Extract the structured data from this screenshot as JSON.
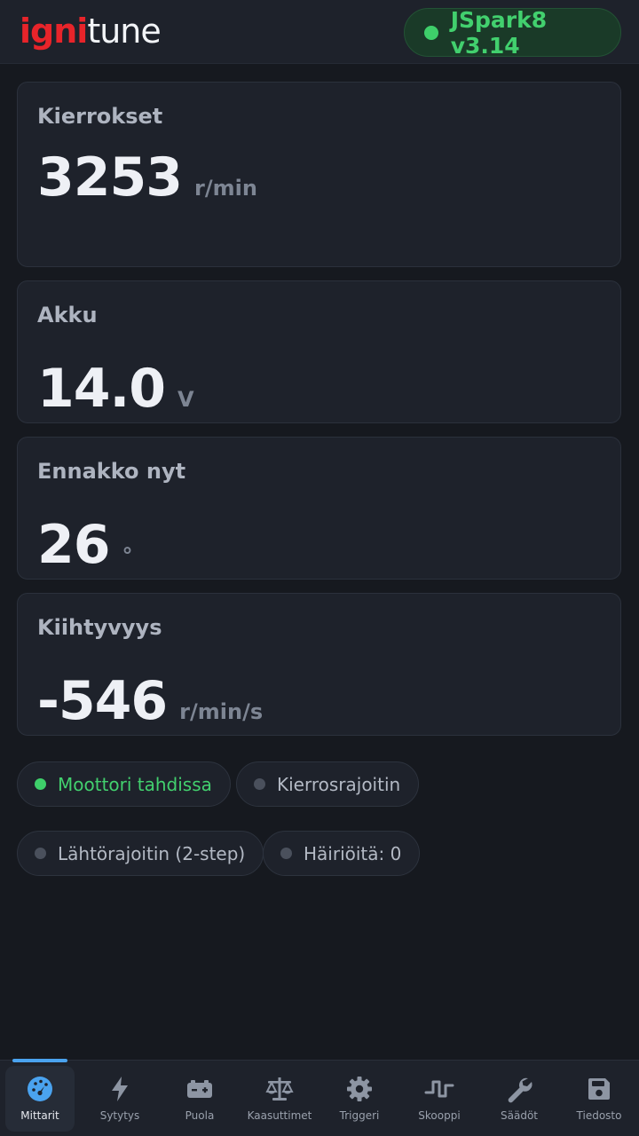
{
  "header": {
    "logo_part1": "igni",
    "logo_part2": "tune",
    "device_label": "JSpark8 v3.14",
    "device_status_color": "#3ecf6a"
  },
  "cards": [
    {
      "title": "Kierrokset",
      "value": "3253",
      "unit": "r/min"
    },
    {
      "title": "Akku",
      "value": "14.0",
      "unit": "V"
    },
    {
      "title": "Ennakko nyt",
      "value": "26",
      "unit": "°"
    },
    {
      "title": "Kiihtyvyys",
      "value": "-546",
      "unit": "r/min/s"
    }
  ],
  "status_chips": [
    {
      "label": "Moottori tahdissa",
      "active": true
    },
    {
      "label": "Kierrosrajoitin",
      "active": false
    },
    {
      "label": "Lähtörajoitin (2-step)",
      "active": false
    },
    {
      "label": "Häiriöitä: 0",
      "active": false
    }
  ],
  "nav": {
    "active_index": 0,
    "items": [
      {
        "label": "Mittarit",
        "icon": "gauge-icon"
      },
      {
        "label": "Sytytys",
        "icon": "lightning-icon"
      },
      {
        "label": "Puola",
        "icon": "battery-icon"
      },
      {
        "label": "Kaasuttimet",
        "icon": "scale-icon"
      },
      {
        "label": "Triggeri",
        "icon": "gear-icon"
      },
      {
        "label": "Skooppi",
        "icon": "pulse-wave-icon"
      },
      {
        "label": "Säädöt",
        "icon": "wrench-icon"
      },
      {
        "label": "Tiedosto",
        "icon": "floppy-disk-icon"
      }
    ]
  },
  "colors": {
    "accent_blue": "#4aa3ef",
    "ok_green": "#42d06e",
    "brand_red": "#e8242a"
  }
}
